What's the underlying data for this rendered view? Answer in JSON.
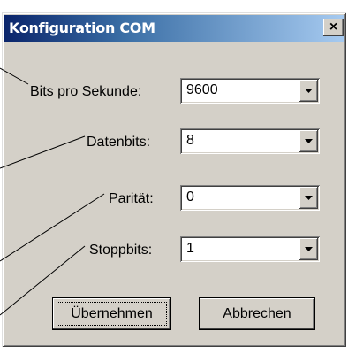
{
  "window": {
    "title": "Konfiguration COM",
    "close_glyph": "×"
  },
  "fields": [
    {
      "label": "Bits pro Sekunde:",
      "value": "9600"
    },
    {
      "label": "Datenbits:",
      "value": "8"
    },
    {
      "label": "Parität:",
      "value": "0"
    },
    {
      "label": "Stoppbits:",
      "value": "1"
    }
  ],
  "buttons": {
    "apply": "Übernehmen",
    "cancel": "Abbrechen"
  },
  "icons": {
    "close": "close-icon",
    "dropdown": "chevron-down-icon"
  },
  "colors": {
    "dialog_face": "#d4d0c8",
    "titlebar_start": "#0a246a",
    "titlebar_end": "#a6caf0"
  }
}
